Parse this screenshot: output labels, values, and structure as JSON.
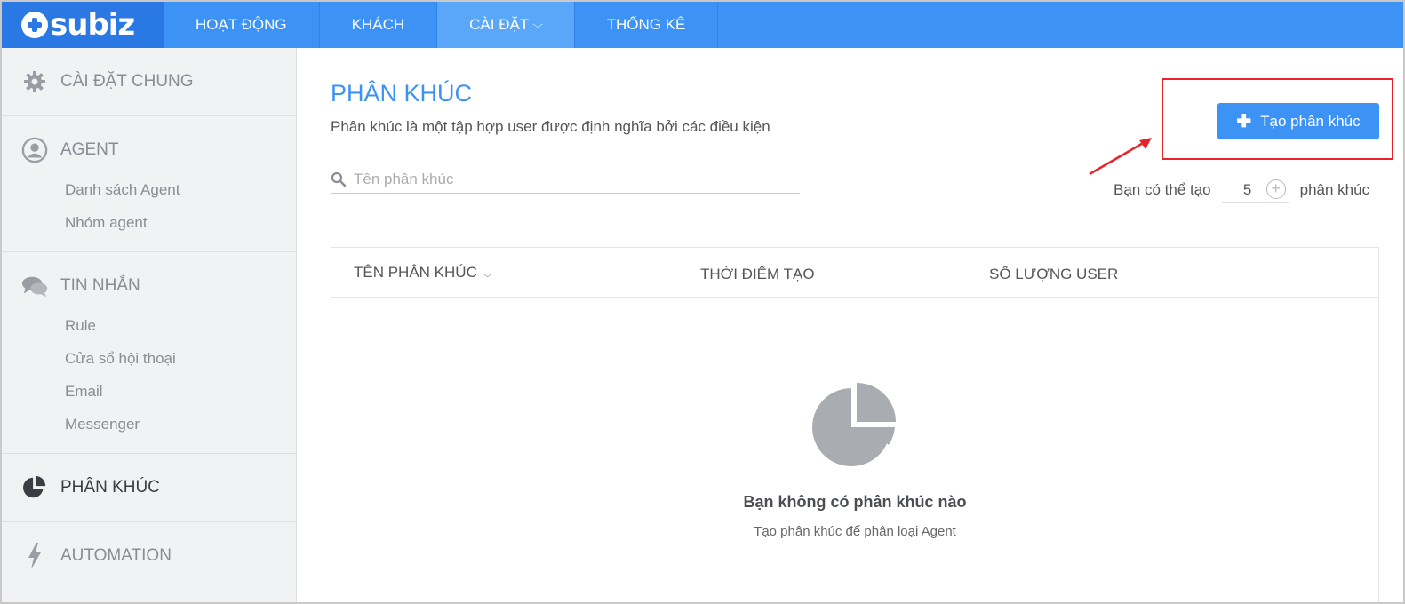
{
  "brand": {
    "logo_text": "subiz"
  },
  "nav": {
    "items": [
      {
        "label": "HOẠT ĐỘNG"
      },
      {
        "label": "KHÁCH"
      },
      {
        "label": "CÀI ĐẶT"
      },
      {
        "label": "THỐNG KÊ"
      }
    ],
    "active_index": 2
  },
  "sidebar": {
    "general": {
      "label": "CÀI ĐẶT CHUNG",
      "icon": "gear-icon"
    },
    "agent": {
      "label": "AGENT",
      "icon": "user-circle-icon",
      "items": [
        "Danh sách Agent",
        "Nhóm agent"
      ]
    },
    "messages": {
      "label": "TIN NHẮN",
      "icon": "chat-bubbles-icon",
      "items": [
        "Rule",
        "Cửa sổ hội thoại",
        "Email",
        "Messenger"
      ]
    },
    "segments": {
      "label": "PHÂN KHÚC",
      "icon": "pie-chart-icon",
      "active": true
    },
    "automation": {
      "label": "AUTOMATION",
      "icon": "lightning-icon"
    }
  },
  "main": {
    "title": "PHÂN KHÚC",
    "description": "Phân khúc là một tập hợp user được định nghĩa bởi các điều kiện",
    "search": {
      "placeholder": "Tên phân khúc",
      "value": ""
    },
    "create_button": {
      "label": "Tạo phân khúc"
    },
    "quota": {
      "prefix": "Bạn có thể tạo",
      "value": "5",
      "suffix": "phân khúc"
    },
    "table": {
      "columns": [
        "TÊN PHÂN KHÚC",
        "THỜI ĐIỂM TẠO",
        "SỐ LƯỢNG USER"
      ],
      "rows": []
    },
    "empty_state": {
      "title": "Bạn không có phân khúc nào",
      "description": "Tạo phân khúc để phân loại Agent"
    }
  },
  "colors": {
    "primary": "#3d92f5",
    "logo_bg": "#2a78e4",
    "sidebar_bg": "#f1f2f4",
    "annotation": "#e8242a"
  }
}
